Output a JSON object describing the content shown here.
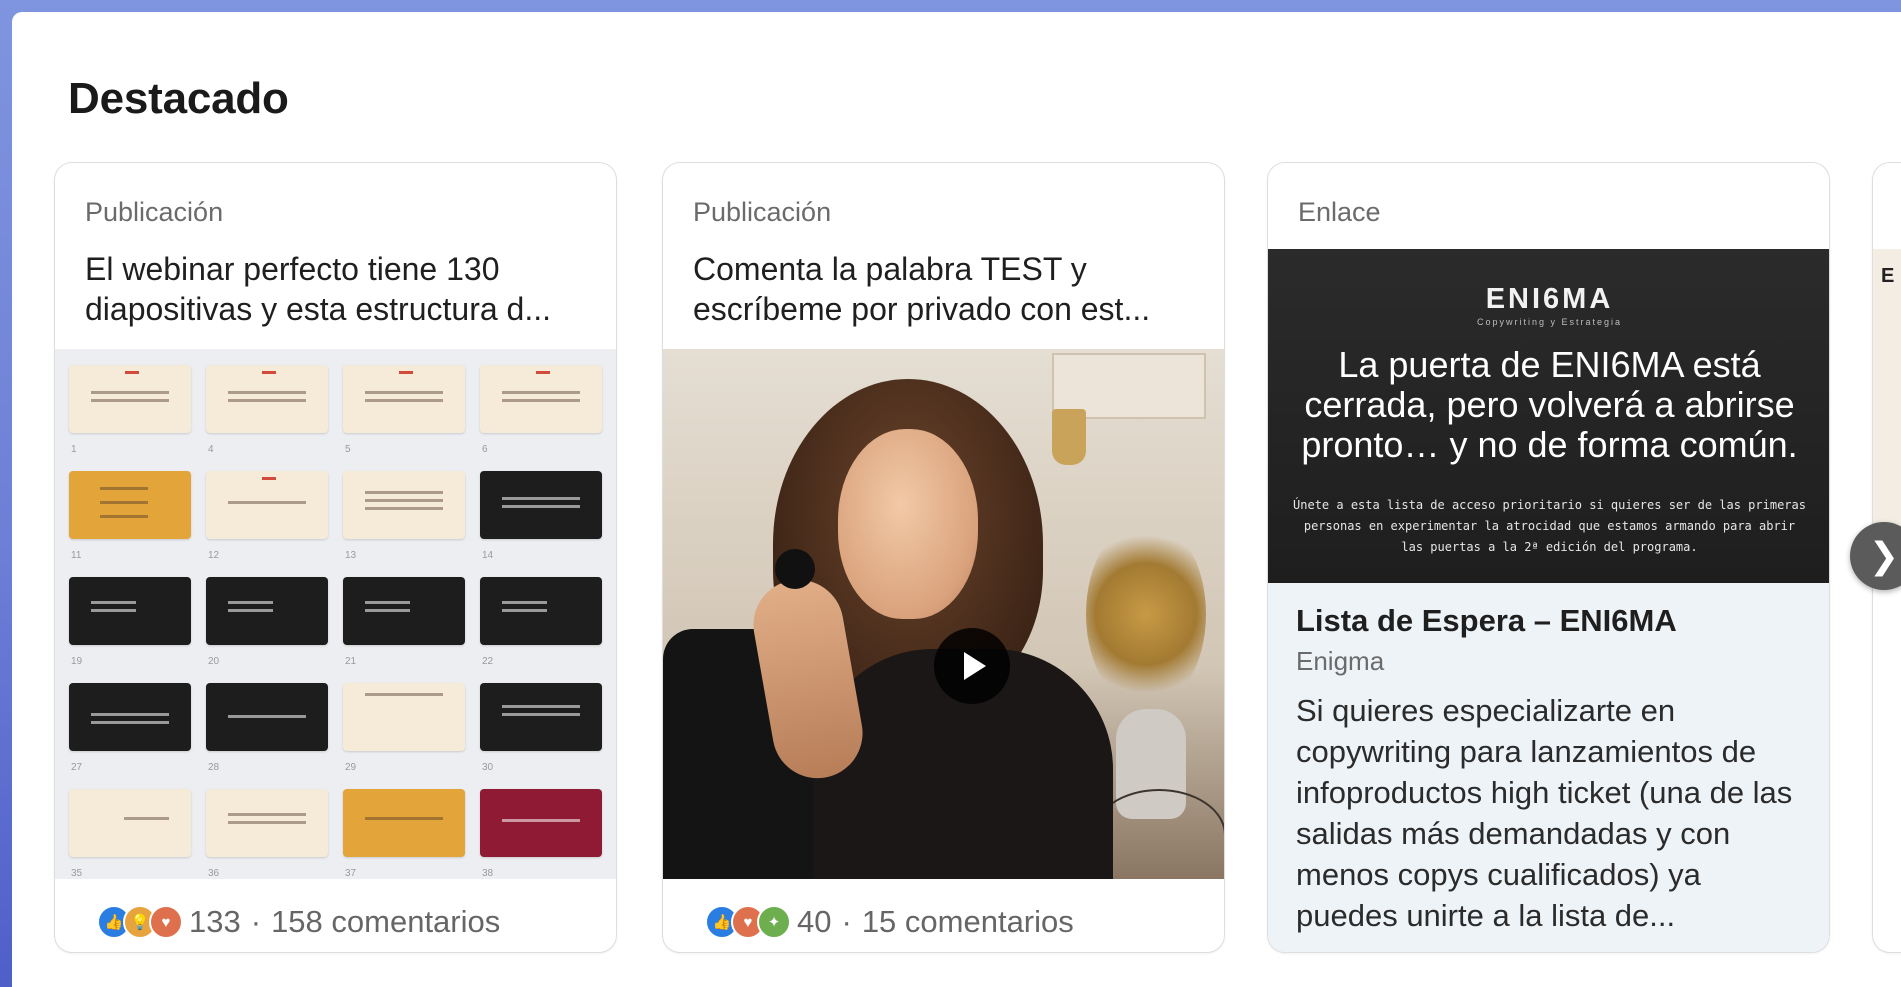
{
  "section": {
    "title": "Destacado"
  },
  "cards": [
    {
      "kind": "Publicación",
      "text": "El webinar perfecto tiene 130 diapositivas y esta estructura d...",
      "reaction_count": "133",
      "separator": "·",
      "comments": "158 comentarios",
      "reactions": [
        "like-icon",
        "insightful-icon",
        "love-icon"
      ]
    },
    {
      "kind": "Publicación",
      "text": "Comenta la palabra TEST y escríbeme por privado con est...",
      "reaction_count": "40",
      "separator": "·",
      "comments": "15 comentarios",
      "reactions": [
        "like-icon",
        "love-icon",
        "support-icon"
      ]
    },
    {
      "kind": "Enlace",
      "banner": {
        "brand": "ENI6MA",
        "brand_sub": "Copywriting y Estrategia",
        "headline": "La puerta de ENI6MA está cerrada, pero volverá a abrirse pronto… y no de forma común.",
        "body": "Únete a esta lista de acceso prioritario si quieres ser de las primeras personas en experimentar la atrocidad que estamos armando para abrir las puertas a la 2ª edición del programa."
      },
      "title": "Lista de Espera – ENI6MA",
      "source": "Enigma",
      "description": "Si quieres especializarte en copywriting para lanzamientos de infoproductos high ticket (una de las salidas más demandadas y con menos copys cualificados) ya puedes unirte a la lista de..."
    },
    {
      "kind": "",
      "peek_text": "E"
    }
  ],
  "next_button": {
    "icon": "chevron-right-icon",
    "glyph": "❯"
  },
  "colors": {
    "background_gradient": [
      "#7f95df",
      "#4f5fc9"
    ],
    "like": "#2a7de1",
    "love": "#df704d",
    "insight": "#e7a33e",
    "support": "#6dae4f"
  }
}
